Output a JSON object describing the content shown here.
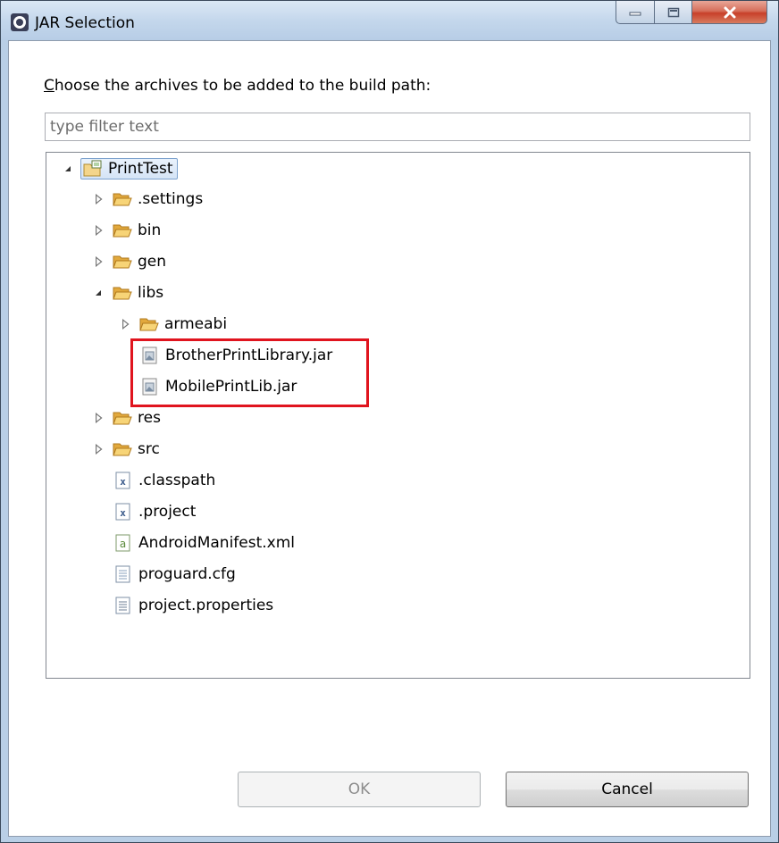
{
  "window": {
    "title": "JAR Selection",
    "minimize_icon": "minimize-icon",
    "maximize_icon": "maximize-icon",
    "close_icon": "close-icon"
  },
  "prompt": {
    "mnemonic": "C",
    "rest": "hoose the archives to be added to the build path:"
  },
  "filter": {
    "placeholder": "type filter text",
    "value": ""
  },
  "tree": {
    "root": {
      "label": "PrintTest",
      "icon": "project-icon",
      "expanded": true
    },
    "items": [
      {
        "label": ".settings",
        "icon": "folder-icon",
        "expanded": false
      },
      {
        "label": "bin",
        "icon": "folder-icon",
        "expanded": false
      },
      {
        "label": "gen",
        "icon": "folder-icon",
        "expanded": false
      },
      {
        "label": "libs",
        "icon": "folder-icon",
        "expanded": true
      },
      {
        "label": "armeabi",
        "icon": "folder-icon",
        "expanded": false
      },
      {
        "label": "BrotherPrintLibrary.jar",
        "icon": "jar-icon"
      },
      {
        "label": "MobilePrintLib.jar",
        "icon": "jar-icon"
      },
      {
        "label": "res",
        "icon": "folder-icon",
        "expanded": false
      },
      {
        "label": "src",
        "icon": "folder-icon",
        "expanded": false
      },
      {
        "label": ".classpath",
        "icon": "xml-file-icon"
      },
      {
        "label": ".project",
        "icon": "xml-file-icon"
      },
      {
        "label": "AndroidManifest.xml",
        "icon": "android-manifest-icon"
      },
      {
        "label": "proguard.cfg",
        "icon": "text-file-icon"
      },
      {
        "label": "project.properties",
        "icon": "properties-file-icon"
      }
    ]
  },
  "buttons": {
    "ok": "OK",
    "cancel": "Cancel",
    "ok_enabled": false
  },
  "colors": {
    "highlight_border": "#e0141e",
    "folder": "#f2c869",
    "title_bar": "#c4d7ec"
  }
}
